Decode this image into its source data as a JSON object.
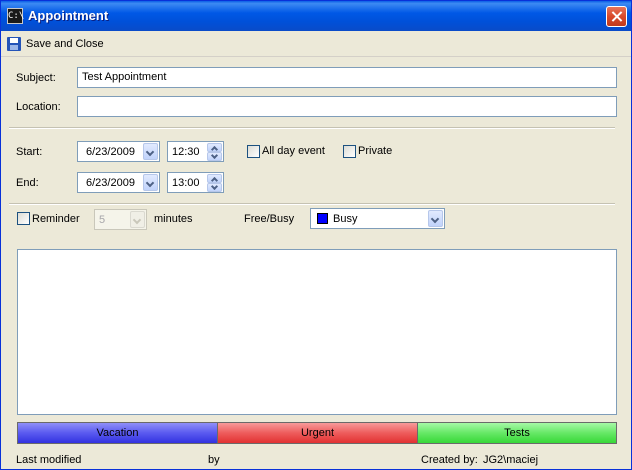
{
  "window": {
    "title": "Appointment",
    "app_icon_text": "C:\\"
  },
  "toolbar": {
    "save_close_label": "Save and Close"
  },
  "form": {
    "subject_label": "Subject:",
    "subject_value": "Test Appointment",
    "location_label": "Location:",
    "location_value": "",
    "start_label": "Start:",
    "start_date": "6/23/2009",
    "start_time": "12:30",
    "end_label": "End:",
    "end_date": "6/23/2009",
    "end_time": "13:00",
    "all_day_label": "All day event",
    "all_day_checked": false,
    "private_label": "Private",
    "private_checked": false,
    "reminder_label": "Reminder",
    "reminder_checked": false,
    "reminder_value": "5",
    "minutes_label": "minutes",
    "freebusy_label": "Free/Busy",
    "freebusy_value": "Busy",
    "freebusy_color": "#0000ff",
    "notes": ""
  },
  "categories": [
    {
      "label": "Vacation",
      "color_top": "#8f8ff8",
      "color_bottom": "#3232e0"
    },
    {
      "label": "Urgent",
      "color_top": "#f79a9a",
      "color_bottom": "#e23232"
    },
    {
      "label": "Tests",
      "color_top": "#a6f8a6",
      "color_bottom": "#38d838"
    }
  ],
  "status": {
    "last_modified_label": "Last modified",
    "by_label": "by",
    "created_by_label": "Created by:",
    "created_by_value": "JG2\\maciej"
  }
}
